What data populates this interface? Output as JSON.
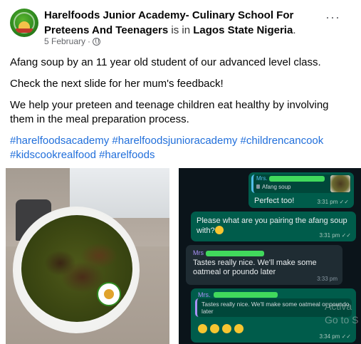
{
  "post": {
    "page_name": "Harelfoods Junior Academy- Culinary School For Preteens And Teenagers",
    "is_in": "is in",
    "location": "Lagos State Nigeria",
    "location_suffix": ".",
    "date": "5 February",
    "date_separator": "·",
    "more_label": "···",
    "paragraphs": [
      "Afang soup by an 11 year old student of our advanced level class.",
      "Check the next slide for her mum's feedback!",
      "We help your preteen and teenage children eat healthy by involving them in the meal preparation process."
    ],
    "hashtags": "#harelfoodsacademy #harelfoodsjunioracademy #childrencancook #kidscookrealfood #harelfoods"
  },
  "chat": {
    "bubble1": {
      "quote_name": "Mrs.",
      "quote_text": "Afang soup",
      "message": "Perfect too!",
      "time": "3:31 pm ✓✓"
    },
    "bubble2": {
      "message": "Please what are you pairing the afang soup with?",
      "time": "3:31 pm ✓✓"
    },
    "bubble3": {
      "sender": "Mrs",
      "message": "Tastes really nice. We'll make some oatmeal or poundo later",
      "time": "3:33 pm"
    },
    "bubble4": {
      "sender": "Mrs.",
      "quote_text": "Tastes really nice. We'll make some oatmeal or poundo later",
      "time": "3:34 pm ✓✓"
    }
  },
  "watermark": {
    "line1": "Activa",
    "line2": "Go to S"
  },
  "colors": {
    "link": "#216fdb",
    "chat_bg": "#0b141a",
    "outgoing_bubble": "#005c4b",
    "incoming_bubble": "#1f2c33"
  }
}
